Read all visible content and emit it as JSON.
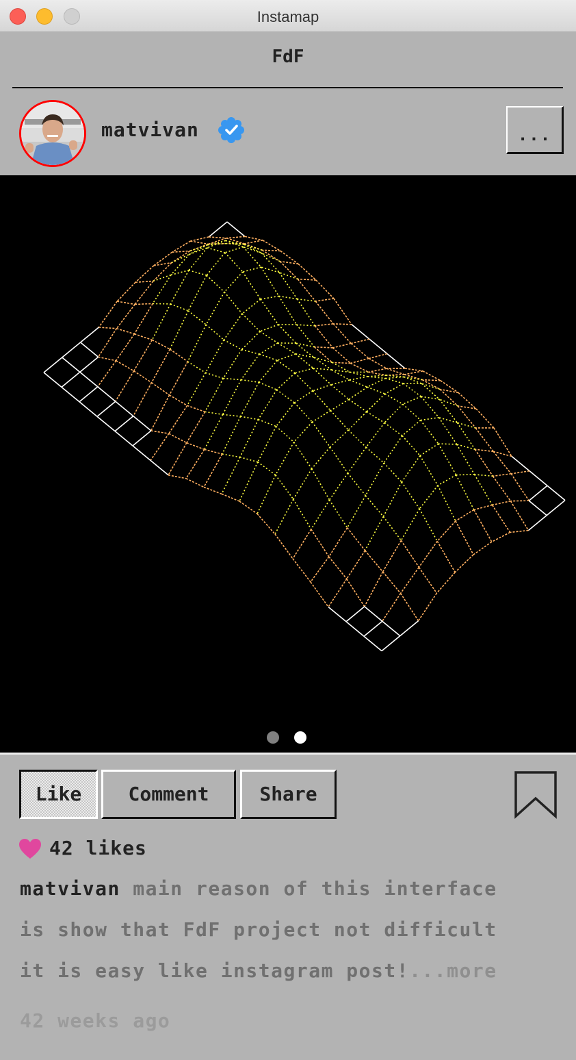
{
  "window": {
    "title": "Instamap"
  },
  "header": {
    "title": "FdF"
  },
  "post": {
    "username": "matvivan",
    "more_label": "...",
    "image_pages": 2,
    "active_page": 2,
    "actions": {
      "like": "Like",
      "comment": "Comment",
      "share": "Share"
    },
    "likes": "42 likes",
    "caption_line1": " main reason of this interface",
    "caption_line2": "is show that FdF project not difficult",
    "caption_line3": "it is easy like instagram post!",
    "more_link": "...more",
    "timestamp": "42 weeks ago"
  },
  "icons": {
    "avatar": "user-avatar-photo",
    "verified": "verified-badge-icon",
    "bookmark": "bookmark-icon",
    "heart": "heart-icon"
  },
  "colors": {
    "background": "#b3b3b3",
    "avatar_ring": "#ff0000",
    "verified": "#3897f0",
    "heart": "#e0479e",
    "wire_base": "#ffffff",
    "wire_mid": "#ffb060",
    "wire_peak": "#ffff40"
  }
}
